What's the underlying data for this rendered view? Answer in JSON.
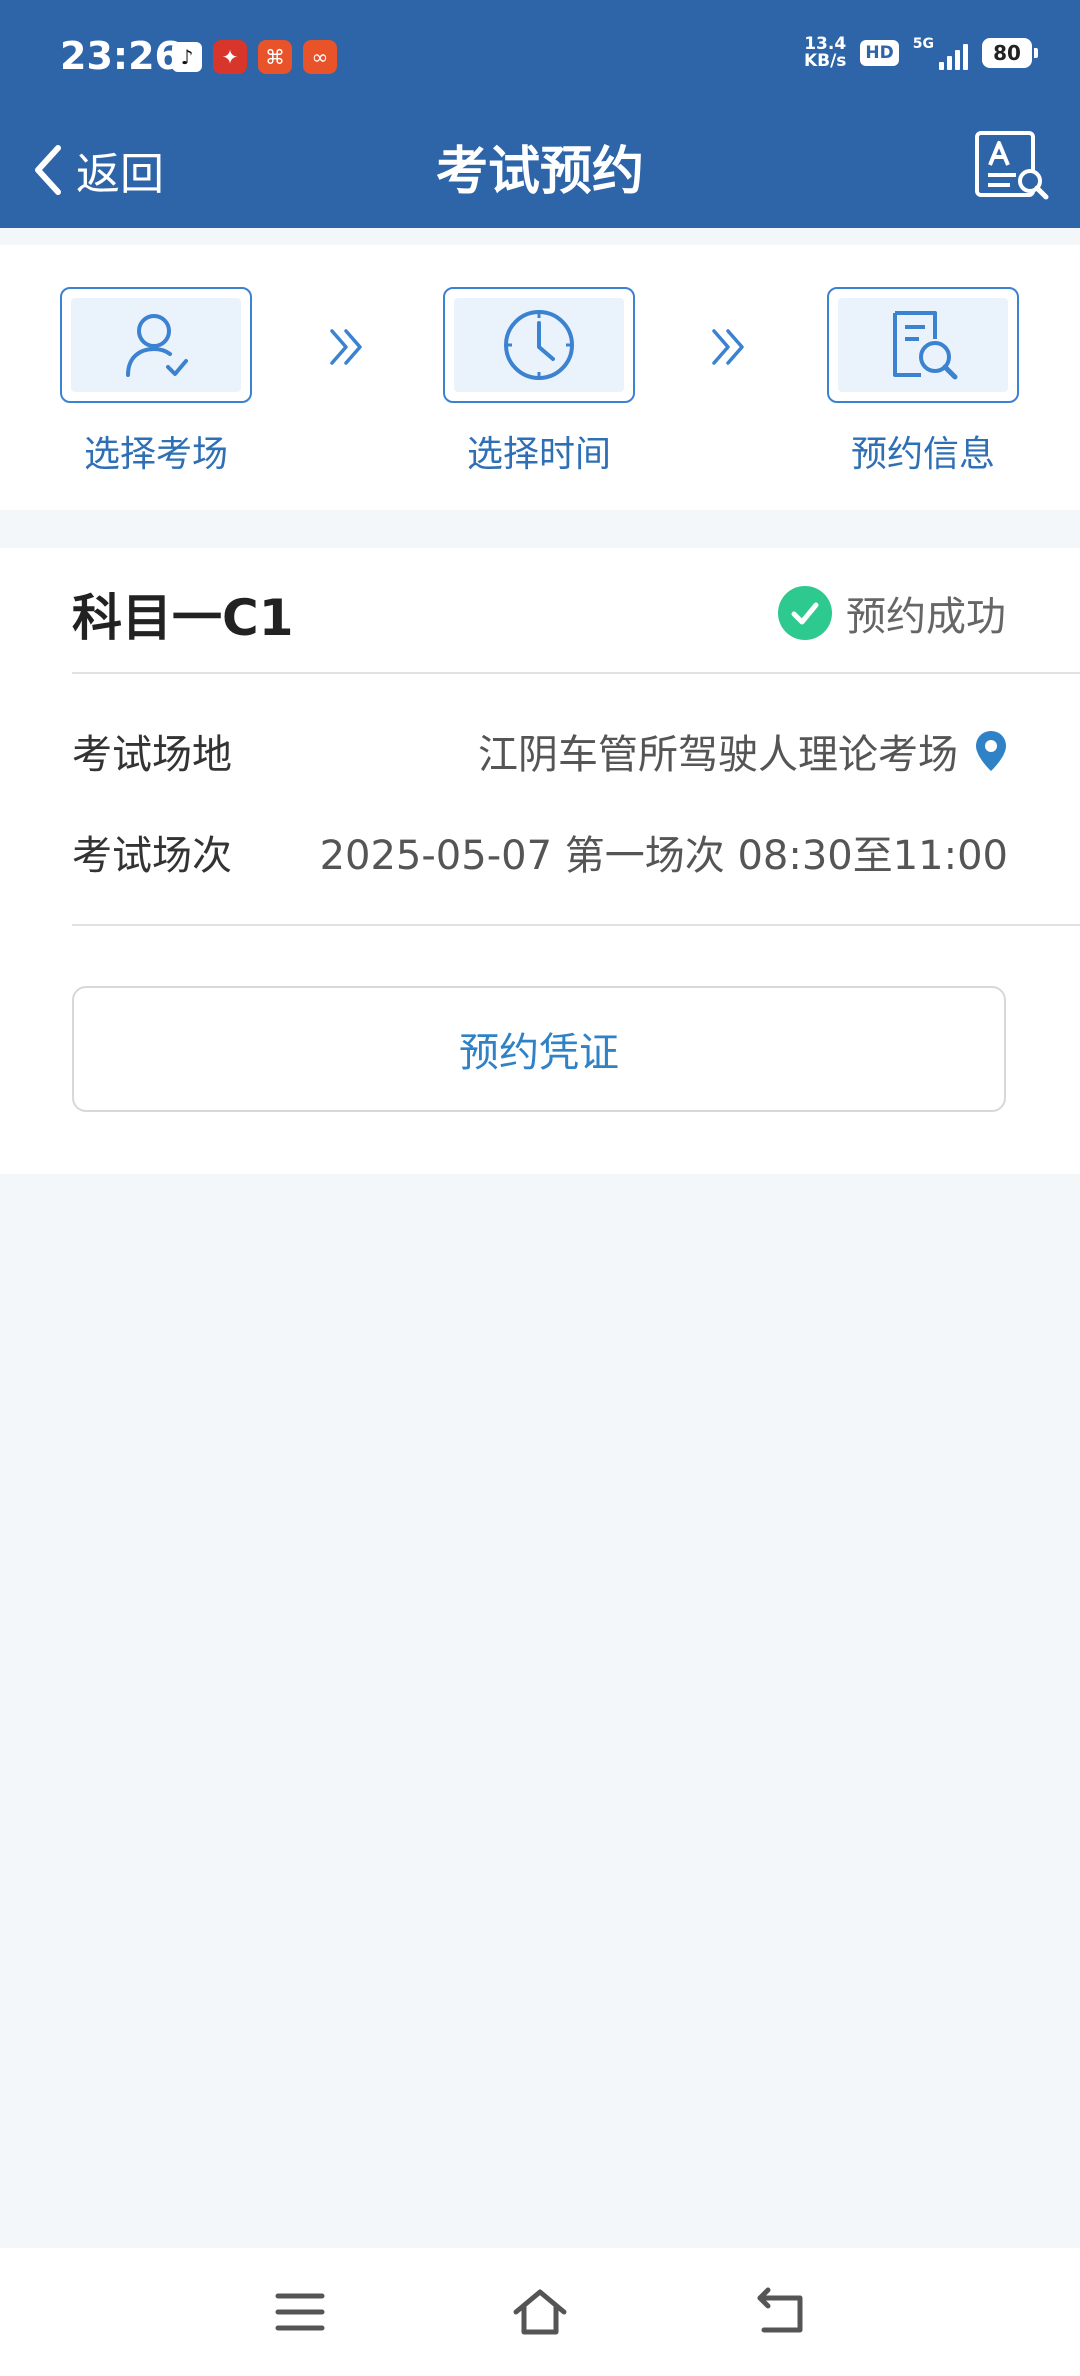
{
  "status_bar": {
    "time": "23:26",
    "apps": [
      {
        "name": "tiktok-icon",
        "glyph": "♪"
      },
      {
        "name": "app-red-icon",
        "glyph": "✦"
      },
      {
        "name": "app-orange-icon",
        "glyph": "⌘"
      },
      {
        "name": "app-red2-icon",
        "glyph": "∞"
      }
    ],
    "net_speed_value": "13.4",
    "net_speed_unit": "KB/s",
    "hd_label": "HD",
    "network_label": "5G",
    "battery": "80"
  },
  "nav": {
    "back_label": "返回",
    "title": "考试预约"
  },
  "steps": [
    {
      "label": "选择考场",
      "icon": "user-check-icon"
    },
    {
      "label": "选择时间",
      "icon": "clock-icon"
    },
    {
      "label": "预约信息",
      "icon": "document-search-icon"
    }
  ],
  "result": {
    "subject": "科目一C1",
    "status": "预约成功",
    "rows": [
      {
        "label": "考试场地",
        "value": "江阴车管所驾驶人理论考场"
      },
      {
        "label": "考试场次",
        "value": "2025-05-07 第一场次 08:30至11:00"
      }
    ],
    "voucher_button": "预约凭证"
  },
  "colors": {
    "header_blue": "#2e64a8",
    "step_blue": "#3b82d0",
    "success_green": "#2ec98e",
    "link_blue": "#2f82c5"
  }
}
